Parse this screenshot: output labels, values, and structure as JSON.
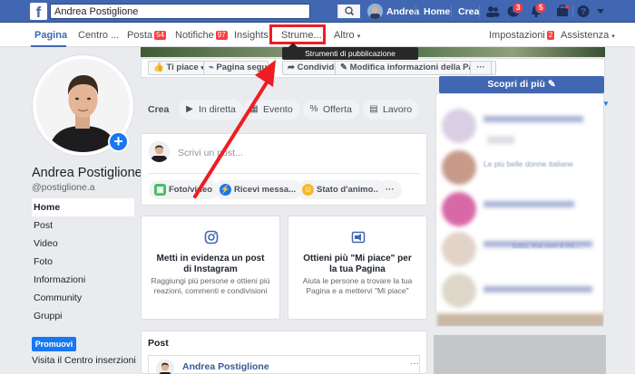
{
  "topbar": {
    "search_value": "Andrea Postiglione",
    "user_name": "Andrea",
    "home_label": "Home",
    "create_label": "Crea",
    "messages_badge": "3",
    "notifications_badge": "5",
    "colors": {
      "bar": "#4267b2"
    }
  },
  "page_nav": {
    "items": [
      {
        "label": "Pagina"
      },
      {
        "label": "Centro ..."
      },
      {
        "label": "Posta",
        "badge": "54"
      },
      {
        "label": "Notifiche",
        "badge": "97"
      },
      {
        "label": "Insights"
      },
      {
        "label": "Strume..."
      },
      {
        "label": "Altro"
      }
    ],
    "settings_label": "Impostazioni",
    "settings_badge": "2",
    "help_label": "Assistenza",
    "tooltip": "Strumenti di pubblicazione"
  },
  "action_bar": {
    "like_label": "Ti piace",
    "follow_label": "Pagina seguita",
    "share_label": "Condividi",
    "edit_label": "Modifica informazioni della Pagina",
    "more_label": "···",
    "discover_label": "Scopri di più"
  },
  "profile": {
    "name": "Andrea Postiglione",
    "handle": "@postiglione.a"
  },
  "sidebar": {
    "items": [
      {
        "label": "Home"
      },
      {
        "label": "Post"
      },
      {
        "label": "Video"
      },
      {
        "label": "Foto"
      },
      {
        "label": "Informazioni"
      },
      {
        "label": "Community"
      },
      {
        "label": "Gruppi"
      }
    ],
    "promote_label": "Promuovi",
    "ads_center_label": "Visita il Centro inserzioni"
  },
  "create": {
    "label": "Crea",
    "buttons": [
      {
        "label": "In diretta"
      },
      {
        "label": "Evento"
      },
      {
        "label": "Offerta"
      },
      {
        "label": "Lavoro"
      }
    ]
  },
  "composer": {
    "placeholder": "Scrivi un post...",
    "buttons": [
      {
        "label": "Foto/video"
      },
      {
        "label": "Ricevi messa..."
      },
      {
        "label": "Stato d'animo..."
      },
      {
        "label": "···"
      }
    ]
  },
  "cards": [
    {
      "title": "Metti in evidenza un post di Instagram",
      "desc": "Raggiungi più persone e ottieni più reazioni, commenti e condivisioni"
    },
    {
      "title": "Ottieni più \"Mi piace\" per la tua Pagina",
      "desc": "Aiuta le persone a trovare la tua Pagina e a mettervi \"Mi piace\""
    }
  ],
  "post_section": {
    "header": "Post",
    "author": "Andrea Postiglione"
  },
  "right_column": {
    "visible_text": [
      "Le più belle donne italiane",
      "tutto, ma non ti mi..."
    ]
  }
}
